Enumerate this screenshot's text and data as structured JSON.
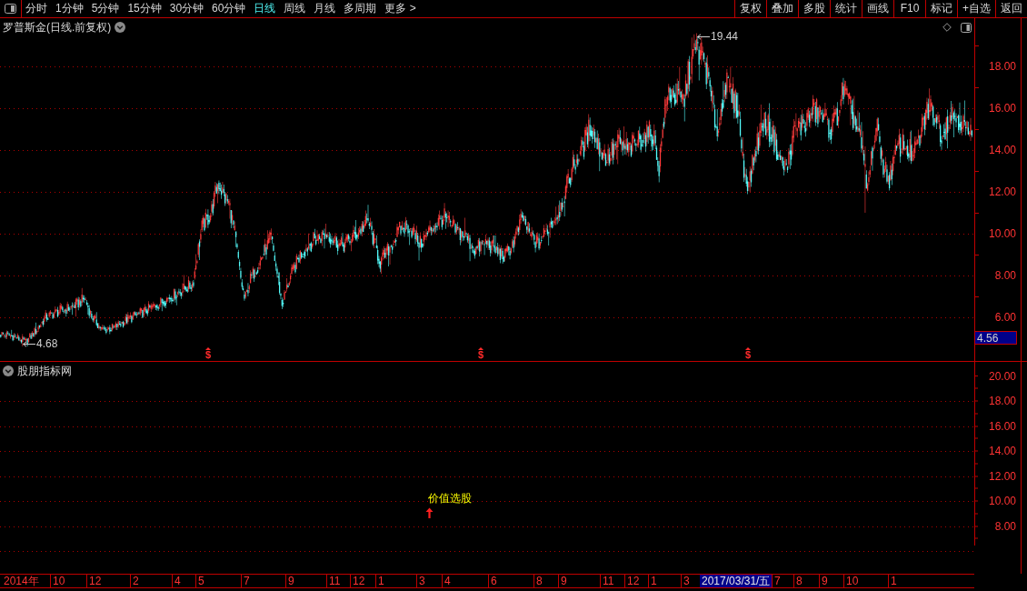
{
  "toolbar": {
    "tabs": [
      {
        "label": "分时",
        "selected": false
      },
      {
        "label": "1分钟",
        "selected": false
      },
      {
        "label": "5分钟",
        "selected": false
      },
      {
        "label": "15分钟",
        "selected": false
      },
      {
        "label": "30分钟",
        "selected": false
      },
      {
        "label": "60分钟",
        "selected": false
      },
      {
        "label": "日线",
        "selected": true
      },
      {
        "label": "周线",
        "selected": false
      },
      {
        "label": "月线",
        "selected": false
      },
      {
        "label": "多周期",
        "selected": false
      },
      {
        "label": "更多 >",
        "selected": false
      }
    ],
    "buttons": [
      "复权",
      "叠加",
      "多股",
      "统计",
      "画线",
      "F10",
      "标记",
      "+自选",
      "返回"
    ]
  },
  "price_pane": {
    "title": "罗普斯金(日线.前复权)",
    "axis_labels": [
      "18.00",
      "16.00",
      "14.00",
      "12.00",
      "10.00",
      "8.00",
      "6.00"
    ],
    "high_label": "19.44",
    "low_label": "4.68",
    "current_price": "4.56",
    "event_markers": [
      "$",
      "$",
      "$"
    ]
  },
  "indicator_pane": {
    "title": "股朋指标网",
    "axis_labels": [
      "20.00",
      "18.00",
      "16.00",
      "14.00",
      "12.00",
      "10.00",
      "8.00"
    ],
    "signal_label": "价值选股"
  },
  "date_axis": {
    "labels": [
      "2014年",
      "10",
      "12",
      "2",
      "4",
      "5",
      "7",
      "9",
      "11",
      "12",
      "1",
      "3",
      "4",
      "6",
      "8",
      "9",
      "11",
      "12",
      "1",
      "3",
      "7",
      "8",
      "9",
      "10",
      "1"
    ],
    "cursor_date": "2017/03/31/五"
  }
}
